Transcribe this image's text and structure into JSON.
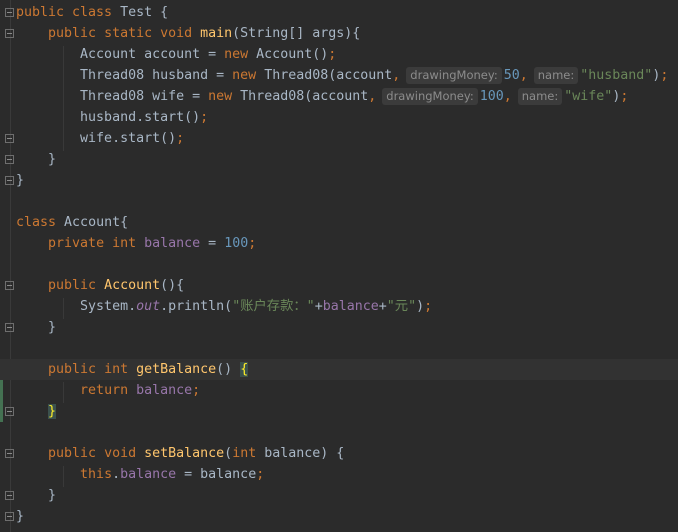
{
  "editor": {
    "colors": {
      "background": "#2B2B2B",
      "keyword": "#CC7832",
      "text": "#A9B7C6",
      "method": "#FFC66D",
      "number": "#6897BB",
      "string": "#6A8759",
      "field": "#9876AA"
    },
    "current_line": 18,
    "fold_icons": [
      1,
      2,
      7,
      8,
      9,
      14,
      16,
      18,
      20,
      22,
      24,
      25
    ],
    "changed_lines": [
      18,
      19,
      20
    ],
    "lines": [
      [
        [
          "kw",
          "public class "
        ],
        [
          "tx",
          "Test {"
        ]
      ],
      [
        [
          "tx",
          "    "
        ],
        [
          "kw",
          "public static void "
        ],
        [
          "md",
          "main"
        ],
        [
          "tx",
          "(String[] args){"
        ]
      ],
      [
        [
          "tx",
          "        Account account = "
        ],
        [
          "kw",
          "new "
        ],
        [
          "tx",
          "Account()"
        ],
        [
          "pu",
          ";"
        ]
      ],
      [
        [
          "tx",
          "        Thread08 husband = "
        ],
        [
          "kw",
          "new "
        ],
        [
          "tx",
          "Thread08(account"
        ],
        [
          "pu",
          ","
        ],
        [
          "hint",
          "drawingMoney:"
        ],
        [
          "nm",
          "50"
        ],
        [
          "pu",
          ","
        ],
        [
          "hint",
          "name:"
        ],
        [
          "st",
          "\"husband\""
        ],
        [
          "tx",
          ")"
        ],
        [
          "pu",
          ";"
        ]
      ],
      [
        [
          "tx",
          "        Thread08 wife = "
        ],
        [
          "kw",
          "new "
        ],
        [
          "tx",
          "Thread08(account"
        ],
        [
          "pu",
          ","
        ],
        [
          "hint",
          "drawingMoney:"
        ],
        [
          "nm",
          "100"
        ],
        [
          "pu",
          ","
        ],
        [
          "hint",
          "name:"
        ],
        [
          "st",
          "\"wife\""
        ],
        [
          "tx",
          ")"
        ],
        [
          "pu",
          ";"
        ]
      ],
      [
        [
          "tx",
          "        husband.start()"
        ],
        [
          "pu",
          ";"
        ]
      ],
      [
        [
          "tx",
          "        wife.start()"
        ],
        [
          "pu",
          ";"
        ]
      ],
      [
        [
          "tx",
          "    }"
        ]
      ],
      [
        [
          "tx",
          "}"
        ]
      ],
      [],
      [
        [
          "kw",
          "class "
        ],
        [
          "tx",
          "Account{"
        ]
      ],
      [
        [
          "tx",
          "    "
        ],
        [
          "kw",
          "private int "
        ],
        [
          "fd",
          "balance"
        ],
        [
          "tx",
          " = "
        ],
        [
          "nm",
          "100"
        ],
        [
          "pu",
          ";"
        ]
      ],
      [],
      [
        [
          "tx",
          "    "
        ],
        [
          "kw",
          "public "
        ],
        [
          "md",
          "Account"
        ],
        [
          "tx",
          "(){"
        ]
      ],
      [
        [
          "tx",
          "        System."
        ],
        [
          "it",
          "out"
        ],
        [
          "tx",
          ".println("
        ],
        [
          "st",
          "\"账户存款：\""
        ],
        [
          "tx",
          "+"
        ],
        [
          "fd",
          "balance"
        ],
        [
          "tx",
          "+"
        ],
        [
          "st",
          "\"元\""
        ],
        [
          "tx",
          ")"
        ],
        [
          "pu",
          ";"
        ]
      ],
      [
        [
          "tx",
          "    }"
        ]
      ],
      [],
      [
        [
          "tx",
          "    "
        ],
        [
          "kw",
          "public int "
        ],
        [
          "md",
          "getBalance"
        ],
        [
          "tx",
          "() "
        ],
        [
          "br",
          "{"
        ]
      ],
      [
        [
          "tx",
          "        "
        ],
        [
          "kw",
          "return "
        ],
        [
          "fd",
          "balance"
        ],
        [
          "pu",
          ";"
        ]
      ],
      [
        [
          "tx",
          "    "
        ],
        [
          "br",
          "}"
        ]
      ],
      [],
      [
        [
          "tx",
          "    "
        ],
        [
          "kw",
          "public void "
        ],
        [
          "md",
          "setBalance"
        ],
        [
          "tx",
          "("
        ],
        [
          "kw",
          "int "
        ],
        [
          "tx",
          "balance) {"
        ]
      ],
      [
        [
          "tx",
          "        "
        ],
        [
          "kw",
          "this"
        ],
        [
          "tx",
          "."
        ],
        [
          "fd",
          "balance"
        ],
        [
          "tx",
          " = balance"
        ],
        [
          "pu",
          ";"
        ]
      ],
      [
        [
          "tx",
          "    }"
        ]
      ],
      [
        [
          "tx",
          "}"
        ]
      ]
    ]
  }
}
